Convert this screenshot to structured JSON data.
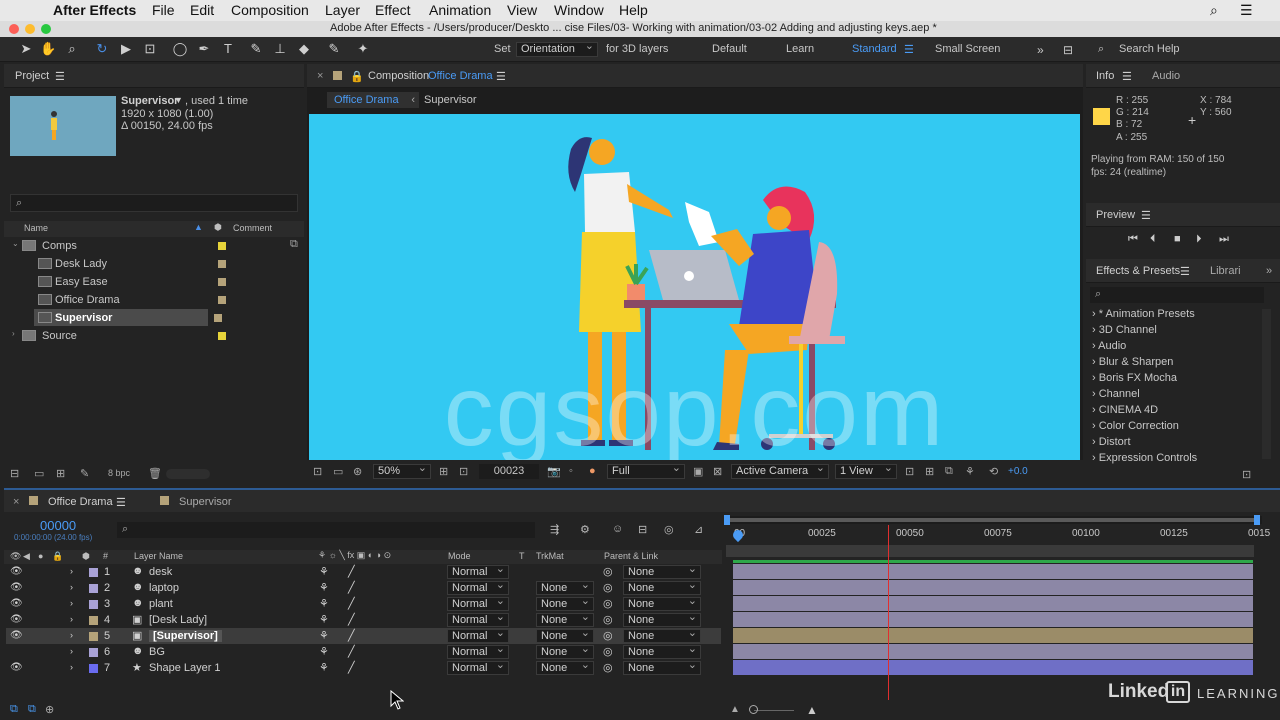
{
  "menubar": {
    "app": "After Effects",
    "items": [
      "File",
      "Edit",
      "Composition",
      "Layer",
      "Effect",
      "Animation",
      "View",
      "Window",
      "Help"
    ]
  },
  "titlebar": {
    "title": "Adobe After Effects - /Users/producer/Deskto ... cise Files/03- Working with animation/03-02 Adding and adjusting keys.aep *"
  },
  "toolbar": {
    "set_label": "Set",
    "orientation": "Orientation",
    "for3d": "for 3D layers",
    "workspaces": [
      "Default",
      "Learn",
      "Standard",
      "Small Screen"
    ],
    "active_workspace": "Standard",
    "search_help": "Search Help"
  },
  "project": {
    "title": "Project",
    "item_name": "Supervisor",
    "used": ", used 1 time",
    "dims": "1920 x 1080 (1.00)",
    "duration": "Δ 00150, 24.00 fps",
    "col_name": "Name",
    "col_comment": "Comment",
    "items": [
      {
        "label": "Comps",
        "type": "folder",
        "color": "#e6d33a"
      },
      {
        "label": "Desk Lady",
        "type": "comp",
        "color": "#b5a37a"
      },
      {
        "label": "Easy Ease",
        "type": "comp",
        "color": "#b5a37a"
      },
      {
        "label": "Office Drama",
        "type": "comp",
        "color": "#b5a37a"
      },
      {
        "label": "Supervisor",
        "type": "comp",
        "color": "#b5a37a"
      },
      {
        "label": "Source",
        "type": "folder",
        "color": "#e6d33a"
      }
    ],
    "bpc": "8 bpc"
  },
  "composition": {
    "panel_label": "Composition",
    "comp_name": "Office Drama",
    "breadcrumbs": [
      "Office Drama",
      "Supervisor"
    ],
    "watermark": "cgsop.com",
    "zoom": "50%",
    "timecode": "00023",
    "resolution": "Full",
    "camera": "Active Camera",
    "views": "1 View",
    "exposure": "+0.0"
  },
  "info": {
    "tabs": [
      "Info",
      "Audio"
    ],
    "r": "R :  255",
    "g": "G : 214",
    "b": "B :  72",
    "a": "A :  255",
    "x": "X :  784",
    "y": "Y :  560",
    "swatch_color": "#ffd648",
    "playing": "Playing from RAM: 150 of 150",
    "fps": "fps: 24 (realtime)"
  },
  "preview": {
    "title": "Preview"
  },
  "effects": {
    "tabs": [
      "Effects & Presets",
      "Librari"
    ],
    "items": [
      "* Animation Presets",
      "3D Channel",
      "Audio",
      "Blur & Sharpen",
      "Boris FX Mocha",
      "Channel",
      "CINEMA 4D",
      "Color Correction",
      "Distort",
      "Expression Controls"
    ]
  },
  "timeline": {
    "tabs": [
      "Office Drama",
      "Supervisor"
    ],
    "timecode": "00000",
    "timecode_sub": "0:00:00:00 (24.00 fps)",
    "col_layer": "Layer Name",
    "col_mode": "Mode",
    "col_t": "T",
    "col_trkmat": "TrkMat",
    "col_parent": "Parent & Link",
    "ruler": [
      "00",
      "00025",
      "00050",
      "00075",
      "00100",
      "00125",
      "0015"
    ],
    "layers": [
      {
        "num": "1",
        "name": "desk",
        "mode": "Normal",
        "trkmat": "",
        "parent": "None",
        "color": "#a9a2d6",
        "bar": "#8c87a6",
        "icon": "person"
      },
      {
        "num": "2",
        "name": "laptop",
        "mode": "Normal",
        "trkmat": "None",
        "parent": "None",
        "color": "#a9a2d6",
        "bar": "#8c87a6",
        "icon": "person"
      },
      {
        "num": "3",
        "name": "plant",
        "mode": "Normal",
        "trkmat": "None",
        "parent": "None",
        "color": "#a9a2d6",
        "bar": "#8c87a6",
        "icon": "person"
      },
      {
        "num": "4",
        "name": "[Desk Lady]",
        "mode": "Normal",
        "trkmat": "None",
        "parent": "None",
        "color": "#b5a37a",
        "bar": "#8c87a6",
        "icon": "comp"
      },
      {
        "num": "5",
        "name": "[Supervisor]",
        "mode": "Normal",
        "trkmat": "None",
        "parent": "None",
        "color": "#b5a37a",
        "bar": "#9b8c68",
        "icon": "comp"
      },
      {
        "num": "6",
        "name": "BG",
        "mode": "Normal",
        "trkmat": "None",
        "parent": "None",
        "color": "#a9a2d6",
        "bar": "#8c87a6",
        "icon": "person"
      },
      {
        "num": "7",
        "name": "Shape Layer 1",
        "mode": "Normal",
        "trkmat": "None",
        "parent": "None",
        "color": "#6a6cf0",
        "bar": "#6f6fc6",
        "icon": "star"
      }
    ],
    "playhead_frame": 23,
    "total_frames": 150
  },
  "branding": {
    "linkedin": "Linked",
    "in": "in",
    "learning": "LEARNING"
  }
}
